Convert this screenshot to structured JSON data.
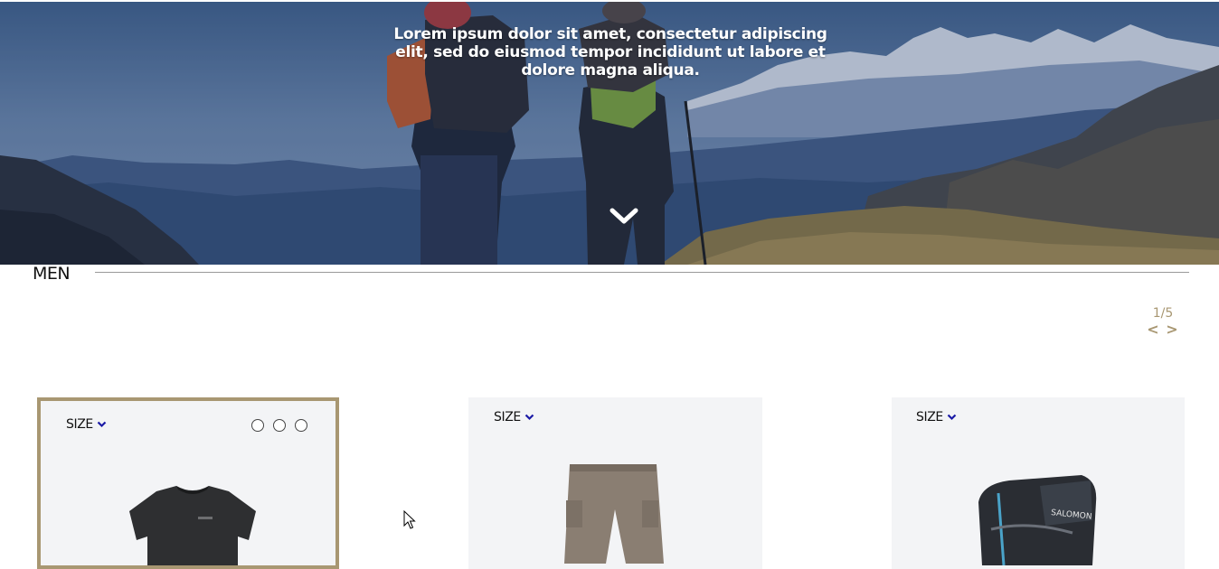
{
  "hero": {
    "tagline": "Lorem ipsum dolor sit amet, consectetur adipiscing elit, sed do eiusmod tempor incididunt ut labore et dolore magna aliqua.",
    "scroll_icon": "chevron-down-icon"
  },
  "section": {
    "title": "MEN"
  },
  "pager": {
    "indicator": "1/5",
    "prev_label": "<",
    "next_label": ">"
  },
  "products": [
    {
      "size_label": "SIZE",
      "item": "t-shirt",
      "active": true,
      "swatch_count": 3
    },
    {
      "size_label": "SIZE",
      "item": "cargo-pants",
      "active": false
    },
    {
      "size_label": "SIZE",
      "item": "backpack",
      "active": false,
      "brand_text": "SALOMON"
    }
  ],
  "colors": {
    "accent": "#a89772",
    "card_bg": "#f3f4f6",
    "dropdown_arrow": "#1a1aa6"
  }
}
